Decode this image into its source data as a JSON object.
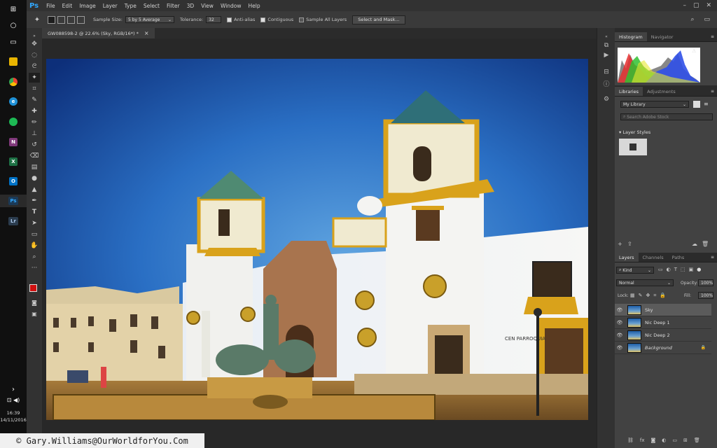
{
  "taskbar": {
    "apps": [
      {
        "name": "start",
        "glyph": "⊞"
      },
      {
        "name": "cortana",
        "glyph": "○"
      },
      {
        "name": "taskview",
        "glyph": "▭"
      },
      {
        "name": "explorer",
        "glyph": "▰",
        "color": "#e8b400"
      },
      {
        "name": "chrome",
        "glyph": "●",
        "color": "#34a853"
      },
      {
        "name": "edge",
        "glyph": "e",
        "color": "#1e90d6"
      },
      {
        "name": "spotify",
        "glyph": "≋",
        "color": "#1db954"
      },
      {
        "name": "onenote",
        "glyph": "N",
        "color": "#80397b"
      },
      {
        "name": "excel",
        "glyph": "X",
        "color": "#1e7145"
      },
      {
        "name": "outlook",
        "glyph": "O",
        "color": "#0072c6"
      },
      {
        "name": "photoshop",
        "glyph": "Ps",
        "color": "#1b3a57"
      },
      {
        "name": "lightroom",
        "glyph": "Lr",
        "color": "#2b3c4e"
      }
    ],
    "time": "16:39",
    "date": "14/11/2016"
  },
  "app": {
    "logo": "Ps"
  },
  "menu": [
    "File",
    "Edit",
    "Image",
    "Layer",
    "Type",
    "Select",
    "Filter",
    "3D",
    "View",
    "Window",
    "Help"
  ],
  "options": {
    "sample_size_label": "Sample Size:",
    "sample_size_value": "5 by 5 Average",
    "tolerance_label": "Tolerance:",
    "tolerance_value": "32",
    "anti_alias": "Anti-alias",
    "contiguous": "Contiguous",
    "sample_all_layers": "Sample All Layers",
    "select_mask": "Select and Mask..."
  },
  "document": {
    "tab_title": "GW088598-2 @ 22.6% (Sky, RGB/16*) *",
    "close_glyph": "×",
    "building_sign": "CEN PARROQUIA"
  },
  "colors": {
    "foreground": "#d01010",
    "background": "#ffffff",
    "accent": "#31a8ff"
  },
  "panels": {
    "histogram_tabs": [
      "Histogram",
      "Navigator"
    ],
    "library_tabs": [
      "Libraries",
      "Adjustments"
    ],
    "library_select": "My Library",
    "library_search": "Search Adobe Stock",
    "layer_styles": "Layer Styles",
    "layers_tabs": [
      "Layers",
      "Channels",
      "Paths"
    ],
    "kind_filter": "Kind",
    "blend_mode": "Normal",
    "opacity_label": "Opacity:",
    "opacity_value": "100%",
    "lock_label": "Lock:",
    "fill_label": "Fill:",
    "fill_value": "100%",
    "layers": [
      {
        "name": "Sky",
        "selected": true,
        "locked": false
      },
      {
        "name": "Nic Deep 1",
        "selected": false,
        "locked": false
      },
      {
        "name": "Nic Deep 2",
        "selected": false,
        "locked": false
      },
      {
        "name": "Background",
        "selected": false,
        "locked": true
      }
    ]
  },
  "watermark": "© Gary.Williams@OurWorldforYou.Com"
}
